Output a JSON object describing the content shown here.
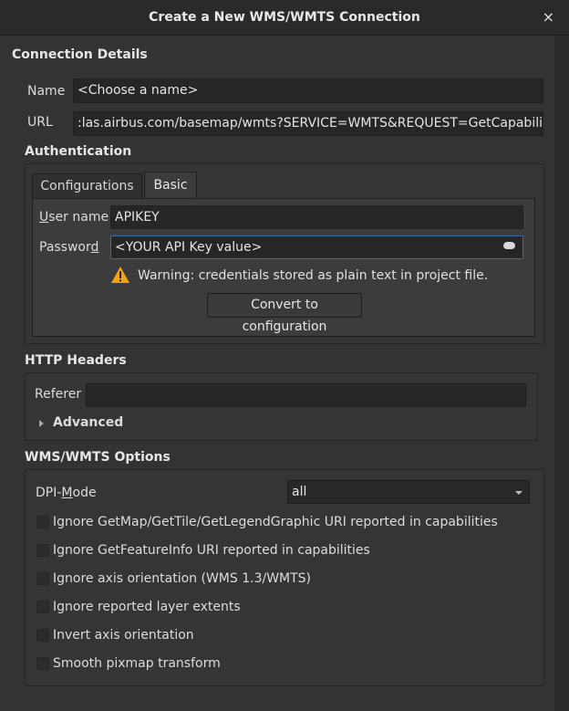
{
  "window": {
    "title": "Create a New WMS/WMTS Connection",
    "close_icon": "×"
  },
  "connection": {
    "section_title": "Connection Details",
    "name_label": "Name",
    "name_value": "<Choose a  name>",
    "url_label": "URL",
    "url_value": ":las.airbus.com/basemap/wmts?SERVICE=WMTS&REQUEST=GetCapabilities"
  },
  "authentication": {
    "section_title": "Authentication",
    "tabs": [
      {
        "label": "Configurations"
      },
      {
        "label": "Basic"
      }
    ],
    "active_tab": "Basic",
    "username_label_u": "U",
    "username_label_rest": "ser name",
    "username_value": "APIKEY",
    "password_label_pre": "Passwor",
    "password_label_u": "d",
    "password_value": "<YOUR API Key value>",
    "warning_text": "Warning: credentials stored as plain text in project file.",
    "convert_button": "Convert to configuration",
    "warning_color": "#f0a30a"
  },
  "http_headers": {
    "section_title": "HTTP Headers",
    "referer_label": "Referer",
    "referer_value": "",
    "advanced_label": "Advanced"
  },
  "options": {
    "section_title": "WMS/WMTS Options",
    "dpi_label_pre": "DPI-",
    "dpi_label_u": "M",
    "dpi_label_rest": "ode",
    "dpi_value": "all",
    "checkboxes": [
      {
        "label": "Ignore GetMap/GetTile/GetLegendGraphic URI reported in capabilities",
        "checked": false
      },
      {
        "label": "Ignore GetFeatureInfo URI reported in capabilities",
        "checked": false
      },
      {
        "label": "Ignore axis orientation (WMS 1.3/WMTS)",
        "checked": false
      },
      {
        "label": "Ignore reported layer extents",
        "checked": false
      },
      {
        "label": "Invert axis orientation",
        "checked": false
      },
      {
        "label": "Smooth pixmap transform",
        "checked": false
      }
    ]
  }
}
